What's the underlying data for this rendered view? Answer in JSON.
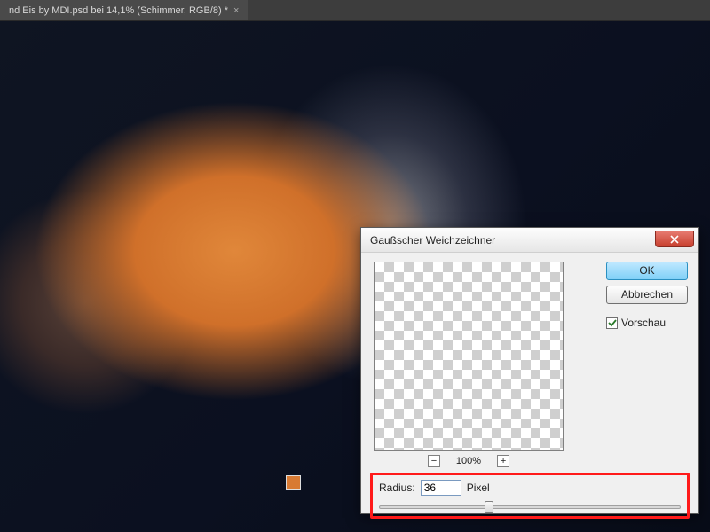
{
  "tab": {
    "title": "nd Eis by MDI.psd bei 14,1% (Schimmer, RGB/8) *"
  },
  "swatch_color": "#d87a33",
  "dialog": {
    "title": "Gaußscher Weichzeichner",
    "ok_label": "OK",
    "cancel_label": "Abbrechen",
    "preview_label": "Vorschau",
    "preview_checked": true,
    "zoom": {
      "minus": "−",
      "percent": "100%",
      "plus": "+"
    },
    "radius_label": "Radius:",
    "radius_value": "36",
    "radius_unit": "Pixel",
    "slider_percent": 36
  }
}
